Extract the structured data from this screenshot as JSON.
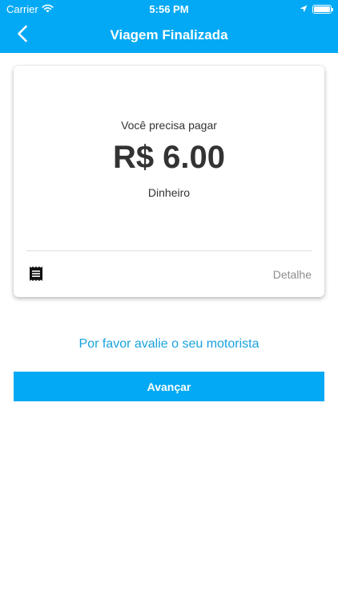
{
  "status_bar": {
    "carrier": "Carrier",
    "time": "5:56 PM",
    "battery_level": 1.0,
    "icons": [
      "wifi-icon",
      "location-arrow-icon",
      "battery-icon"
    ]
  },
  "nav": {
    "title": "Viagem Finalizada",
    "back_icon": "chevron-left-icon"
  },
  "payment_card": {
    "prompt": "Você precisa pagar",
    "amount": "R$ 6.00",
    "method": "Dinheiro",
    "receipt_icon": "receipt-icon",
    "detail_label": "Detalhe"
  },
  "rate_driver_text": "Por favor avalie o seu motorista",
  "next_button_label": "Avançar",
  "colors": {
    "primary": "#03a9f4",
    "link": "#1aa3df",
    "text": "#333333",
    "muted": "#8e8e8e"
  }
}
